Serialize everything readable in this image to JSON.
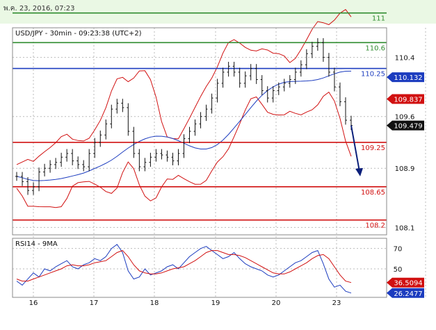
{
  "header": {
    "datetime": "พ.ค. 23, 2016, 07:23"
  },
  "chart_data": [
    {
      "type": "line",
      "title": "USD/JPY - 30min - 09:23:38 (UTC+2)",
      "ylim": [
        108.0,
        110.8
      ],
      "y_ticks": [
        {
          "value": 110.4,
          "label": "110.4"
        },
        {
          "value": 109.6,
          "label": "109.6"
        },
        {
          "value": 108.9,
          "label": "108.9"
        },
        {
          "value": 108.1,
          "label": "108.1"
        }
      ],
      "x_ticks": [
        "16",
        "17",
        "18",
        "19",
        "20",
        "23"
      ],
      "levels": [
        {
          "value": 111.0,
          "label": "111",
          "color": "#2e8b2e"
        },
        {
          "value": 110.6,
          "label": "110.6",
          "color": "#2e8b2e"
        },
        {
          "value": 110.25,
          "label": "110.25",
          "color": "#1c3cbf"
        },
        {
          "value": 109.25,
          "label": "109.25",
          "color": "#d11010"
        },
        {
          "value": 108.65,
          "label": "108.65",
          "color": "#d11010"
        },
        {
          "value": 108.2,
          "label": "108.2",
          "color": "#d11010"
        }
      ],
      "price_badges": [
        {
          "value": 110.132,
          "label": "110.132",
          "color": "#1c3cbf"
        },
        {
          "value": 109.837,
          "label": "109.837",
          "color": "#d11010"
        },
        {
          "value": 109.479,
          "label": "109.479",
          "color": "#111111"
        }
      ],
      "price_series": [
        108.79,
        108.72,
        108.6,
        108.65,
        108.85,
        108.9,
        108.95,
        108.98,
        109.05,
        109.1,
        109.0,
        108.95,
        108.92,
        109.1,
        109.25,
        109.35,
        109.5,
        109.7,
        109.78,
        109.72,
        109.4,
        109.1,
        108.92,
        108.98,
        109.05,
        109.1,
        109.08,
        109.05,
        109.0,
        109.1,
        109.3,
        109.4,
        109.5,
        109.6,
        109.7,
        109.85,
        110.05,
        110.2,
        110.28,
        110.2,
        110.05,
        110.15,
        110.25,
        110.1,
        109.95,
        109.85,
        109.95,
        110.0,
        110.05,
        110.1,
        110.2,
        110.3,
        110.45,
        110.55,
        110.6,
        110.4,
        110.2,
        110.0,
        109.8,
        109.55,
        109.479
      ],
      "forecast_arrow": {
        "from": 109.479,
        "to": 108.8
      }
    },
    {
      "type": "line",
      "title": "RSI14 - 9MA",
      "ylim": [
        22,
        80
      ],
      "y_ticks": [
        {
          "value": 70,
          "label": "70"
        },
        {
          "value": 50,
          "label": "50"
        }
      ],
      "value_badges": [
        {
          "value": 36.5094,
          "label": "36.5094",
          "color": "#d11010"
        },
        {
          "value": 26.2477,
          "label": "26.2477",
          "color": "#1c3cbf"
        }
      ],
      "rsi_series": [
        38,
        34,
        40,
        46,
        42,
        50,
        48,
        52,
        55,
        58,
        52,
        50,
        54,
        56,
        60,
        58,
        62,
        70,
        74,
        66,
        48,
        40,
        42,
        50,
        44,
        46,
        48,
        52,
        54,
        50,
        56,
        62,
        66,
        70,
        72,
        68,
        64,
        60,
        62,
        66,
        60,
        55,
        52,
        50,
        48,
        44,
        42,
        44,
        48,
        52,
        56,
        58,
        62,
        66,
        68,
        55,
        40,
        32,
        34,
        28,
        26.2477
      ],
      "ma_series": [
        40,
        38,
        38,
        40,
        42,
        44,
        46,
        48,
        50,
        53,
        54,
        53,
        53,
        54,
        56,
        57,
        58,
        62,
        66,
        68,
        62,
        54,
        48,
        46,
        45,
        45,
        46,
        48,
        50,
        51,
        52,
        55,
        58,
        62,
        66,
        68,
        68,
        66,
        64,
        64,
        63,
        61,
        58,
        55,
        52,
        49,
        46,
        45,
        45,
        47,
        50,
        53,
        56,
        60,
        63,
        64,
        60,
        52,
        44,
        38,
        36.5094
      ]
    }
  ]
}
